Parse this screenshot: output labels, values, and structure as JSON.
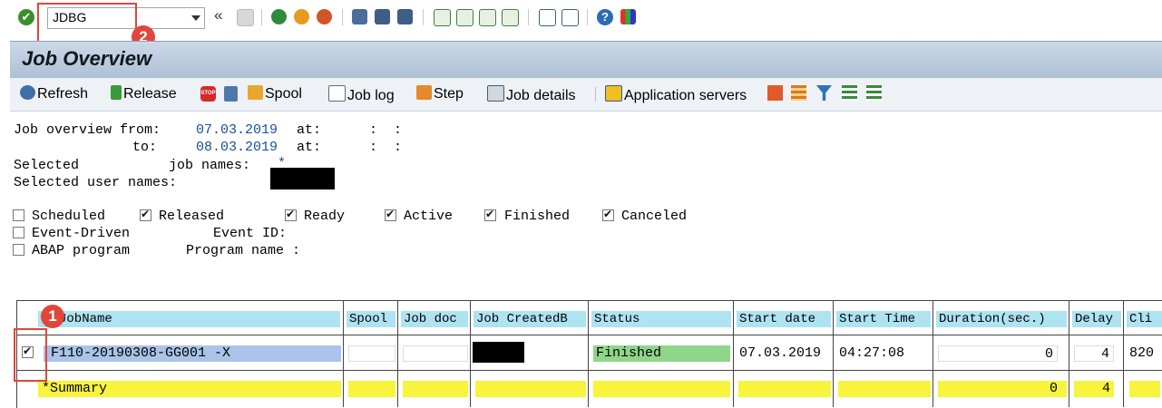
{
  "toolbar": {
    "command_field_value": "JDBG",
    "nav_chevron": "«",
    "annotation_1": "1",
    "annotation_2": "2"
  },
  "title": "Job Overview",
  "app_toolbar": {
    "refresh": "Refresh",
    "release": "Release",
    "spool": "Spool",
    "job_log": "Job log",
    "step": "Step",
    "job_details": "Job details",
    "application_servers": "Application servers"
  },
  "criteria": {
    "from_label": "Job overview from:",
    "from_date": "07.03.2019",
    "to_label": "to:",
    "to_date": "08.03.2019",
    "at_label": "at:",
    "time_placeholder": ":  :",
    "selected_label": "Selected",
    "job_names_label": "job names:",
    "job_names_value": "*",
    "user_names_label": "Selected user names:"
  },
  "status_filters": [
    {
      "label": "Scheduled",
      "checked": false
    },
    {
      "label": "Released",
      "checked": true
    },
    {
      "label": "Ready",
      "checked": true
    },
    {
      "label": "Active",
      "checked": true
    },
    {
      "label": "Finished",
      "checked": true
    },
    {
      "label": "Canceled",
      "checked": true
    }
  ],
  "event_driven": {
    "label": "Event-Driven",
    "checked": false,
    "event_id_label": "Event ID:"
  },
  "abap_program": {
    "label": "ABAP program",
    "checked": false,
    "program_name_label": "Program name :"
  },
  "table": {
    "columns": [
      "JobName",
      "Spool",
      "Job doc",
      "Job CreatedB",
      "Status",
      "Start date",
      "Start Time",
      "Duration(sec.)",
      "Delay",
      "Cli"
    ],
    "rows": [
      {
        "selected": true,
        "job_name": "F110-20190308-GG001 -X",
        "spool": "",
        "job_doc": "",
        "status": "Finished",
        "start_date": "07.03.2019",
        "start_time": "04:27:08",
        "duration": "0",
        "delay": "4",
        "client": "820"
      }
    ],
    "summary": {
      "label": "*Summary",
      "duration": "0",
      "delay": "4"
    }
  },
  "colors": {
    "annotation": "#e0463c",
    "header_cell": "#aee3f2",
    "selected_row": "#a9c4e8",
    "finished_status": "#8fd68a",
    "summary_row": "#f8f43c"
  }
}
